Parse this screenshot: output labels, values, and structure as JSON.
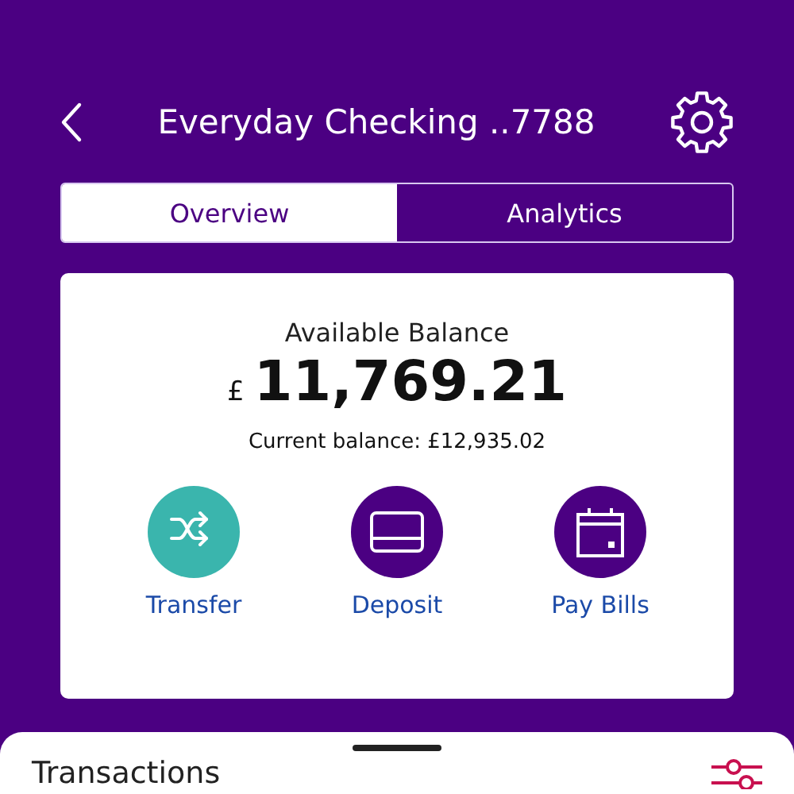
{
  "header": {
    "title": "Everyday Checking ..7788"
  },
  "tabs": [
    {
      "label": "Overview",
      "selected": true
    },
    {
      "label": "Analytics",
      "selected": false
    }
  ],
  "balance": {
    "label": "Available Balance",
    "currency": "£",
    "amount": "11,769.21",
    "current": "Current balance: £12,935.02"
  },
  "actions": [
    {
      "kind": "transfer",
      "label": "Transfer",
      "color": "#3ab5ad"
    },
    {
      "kind": "deposit",
      "label": "Deposit",
      "color": "#4b0082"
    },
    {
      "kind": "bills",
      "label": "Pay Bills",
      "color": "#4b0082"
    }
  ],
  "transactions": {
    "title": "Transactions"
  }
}
